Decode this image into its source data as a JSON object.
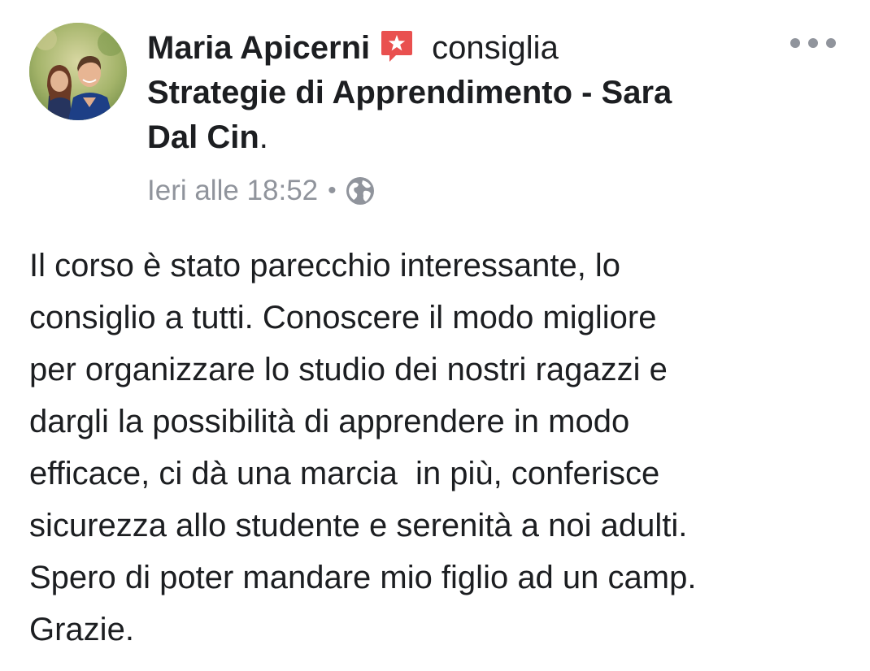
{
  "post": {
    "author": "Maria Apicerni",
    "recommend_icon": "recommendation-star-icon",
    "verb": "consiglia",
    "page_name_line1": "Strategie di Apprendimento - Sara",
    "page_name_line2": "Dal Cin",
    "period": ".",
    "timestamp": "Ieri alle 18:52",
    "separator": "•",
    "privacy_icon": "globe-icon",
    "more_icon": "more-options-icon",
    "body_lines": [
      "Il corso è stato parecchio interessante, lo",
      "consiglio a tutti. Conoscere il modo migliore",
      "per organizzare lo studio dei nostri ragazzi e",
      "dargli la possibilità di apprendere in modo",
      "efficace, ci dà una marcia  in più, conferisce",
      "sicurezza allo studente e serenità a noi adulti.",
      "Spero di poter mandare mio figlio ad un camp.",
      "Grazie."
    ]
  },
  "colors": {
    "text": "#1c1e21",
    "meta": "#90949c",
    "recommend_red": "#e9504f"
  }
}
